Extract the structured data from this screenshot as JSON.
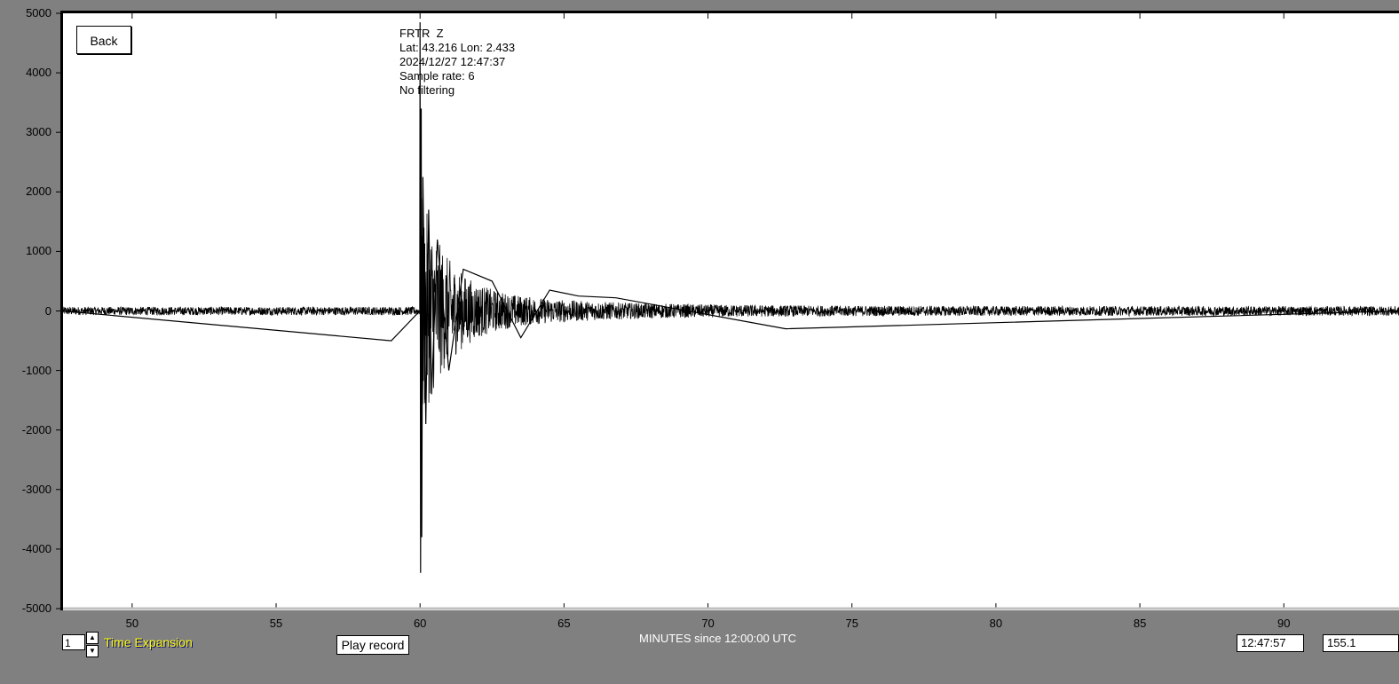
{
  "back_button": "Back",
  "info": {
    "station": "FRTR  Z",
    "location": "Lat: 43.216 Lon: 2.433",
    "datetime": "2024/12/27 12:47:37",
    "sample_rate": "Sample rate: 6",
    "filtering": "No filtering"
  },
  "controls": {
    "time_expansion_value": "1",
    "time_expansion_label": "Time Expansion",
    "play_button": "Play record",
    "time_field": "12:47:57",
    "value_field": "155.1"
  },
  "colors": {
    "background": "#808080",
    "plot_background": "#ffffff",
    "trace": "#000000",
    "expansion_label": "#ffff00"
  },
  "chart_data": {
    "type": "line",
    "title": "",
    "xlabel": "MINUTES since 12:00:00 UTC",
    "ylabel": "",
    "xlim": [
      47.6,
      94.0
    ],
    "ylim": [
      -5000,
      5000
    ],
    "xticks": [
      50,
      55,
      60,
      65,
      70,
      75,
      80,
      85,
      90
    ],
    "yticks": [
      5000,
      4000,
      3000,
      2000,
      1000,
      0,
      -1000,
      -2000,
      -3000,
      -4000,
      -5000
    ],
    "grid": false,
    "event_onset": 60.0,
    "series": [
      {
        "values_desc": "seismogram",
        "points": [
          [
            47.6,
            0
          ],
          [
            59.0,
            -500
          ],
          [
            59.99,
            0
          ],
          [
            60.0,
            4850
          ],
          [
            60.02,
            -4400
          ],
          [
            60.04,
            3400
          ],
          [
            60.06,
            -3800
          ],
          [
            60.1,
            2250
          ],
          [
            60.2,
            -1900
          ],
          [
            60.3,
            1700
          ],
          [
            60.4,
            -1400
          ],
          [
            60.6,
            1200
          ],
          [
            61.0,
            -1000
          ],
          [
            61.5,
            700
          ],
          [
            62.5,
            500
          ],
          [
            63.5,
            -450
          ],
          [
            64.5,
            350
          ],
          [
            65.5,
            250
          ],
          [
            66.8,
            220
          ],
          [
            72.7,
            -300
          ],
          [
            94.0,
            0
          ]
        ]
      }
    ]
  }
}
